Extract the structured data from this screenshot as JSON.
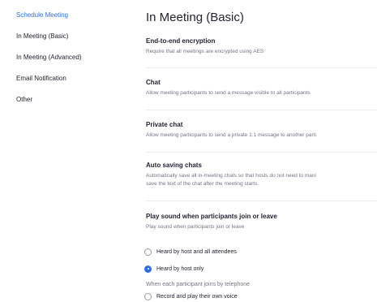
{
  "sidebar": {
    "items": [
      {
        "label": "Schedule Meeting"
      },
      {
        "label": "In Meeting (Basic)"
      },
      {
        "label": "In Meeting (Advanced)"
      },
      {
        "label": "Email Notification"
      },
      {
        "label": "Other"
      }
    ],
    "active_color": "#2d6ee8"
  },
  "main": {
    "title": "In Meeting (Basic)",
    "settings": [
      {
        "title": "End-to-end encryption",
        "desc": "Require that all meetings are encrypted using AES"
      },
      {
        "title": "Chat",
        "desc": "Allow meeting participants to send a message visible to all participants"
      },
      {
        "title": "Private chat",
        "desc": "Allow meeting participants to send a private 1:1 message to another parti"
      },
      {
        "title": "Auto saving chats",
        "desc": "Automatically save all in-meeting chats so that hosts do not need to mani",
        "desc2": "save the text of the chat after the meeting starts."
      },
      {
        "title": "Play sound when participants join or leave",
        "desc": "Play sound when participants join or leave"
      }
    ],
    "radio_options": [
      {
        "label": "Heard by host and all attendees",
        "checked": false
      },
      {
        "label": "Heard by host only",
        "checked": true
      }
    ],
    "telephone_note": "When each participant joins by telephone",
    "telephone_option": {
      "label": "Record and play their own voice",
      "checked": false
    }
  }
}
